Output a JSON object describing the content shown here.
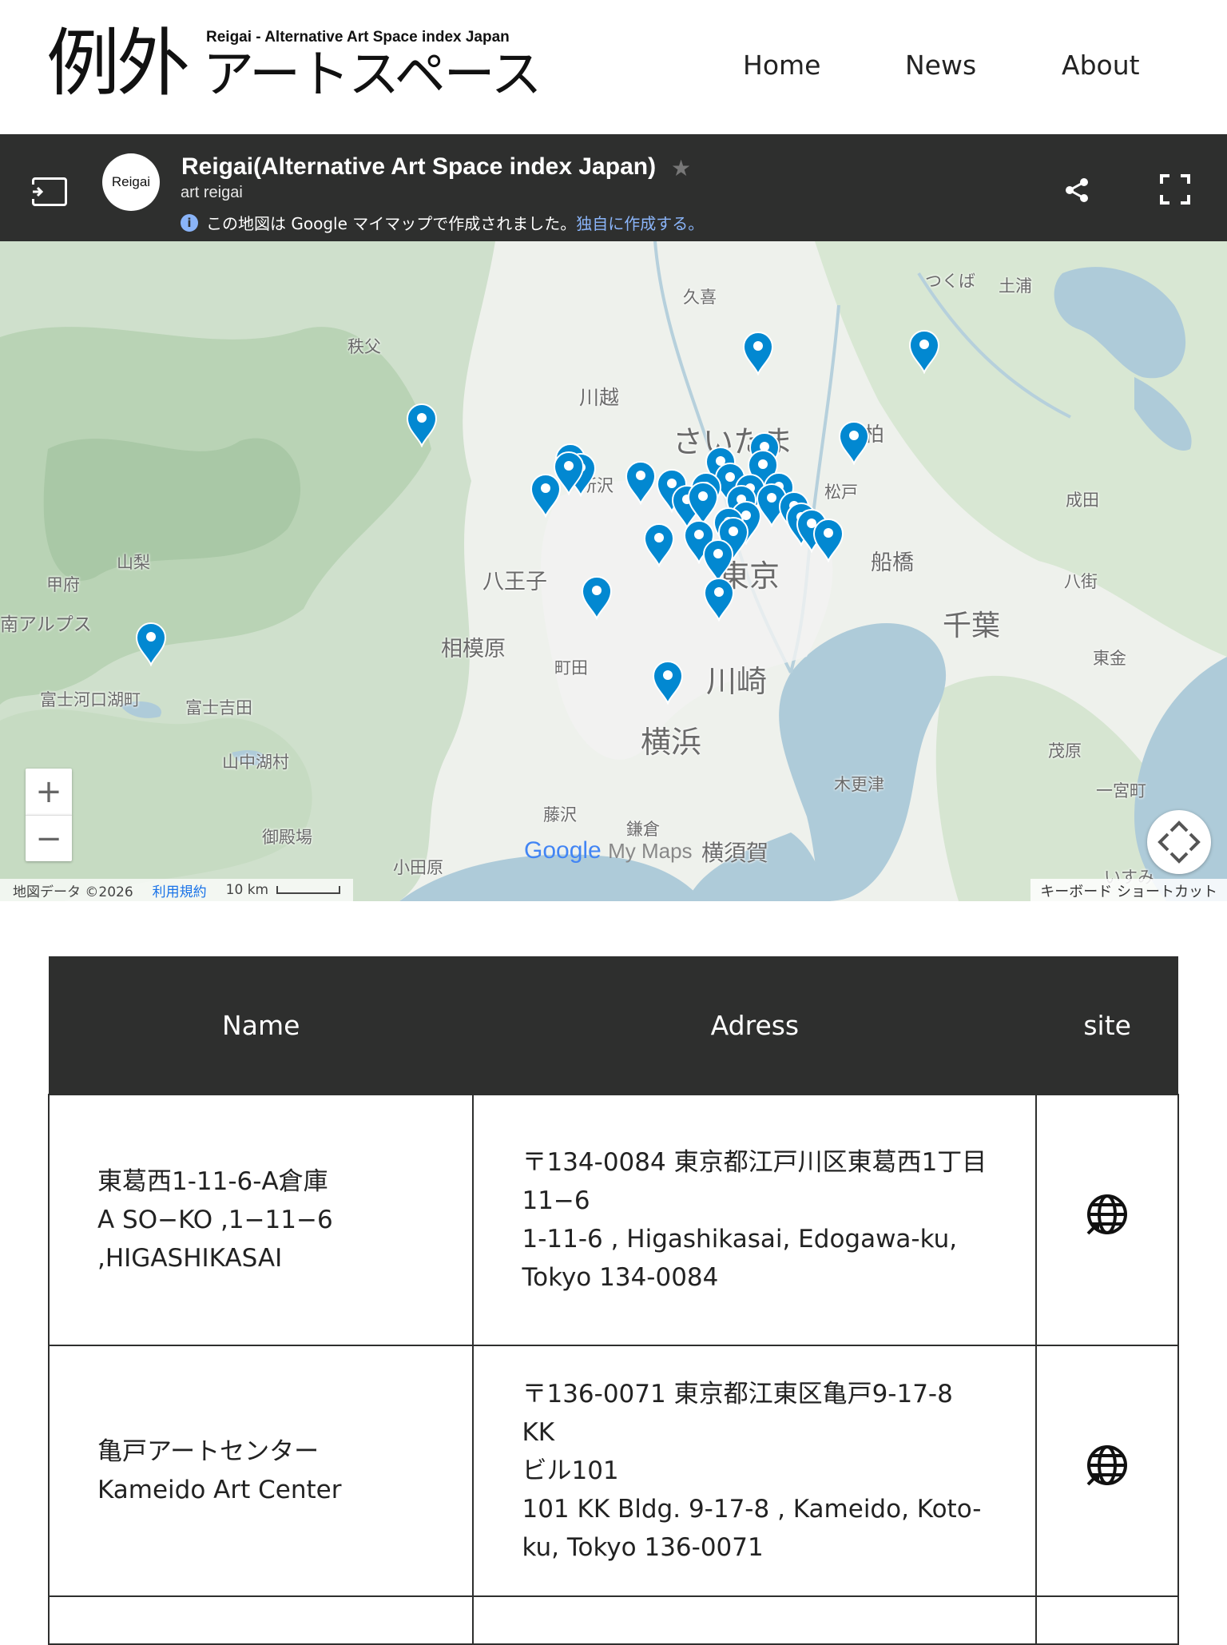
{
  "header": {
    "logo_kanji": "例外",
    "logo_sub": "Reigai - Alternative Art Space index Japan",
    "logo_kana": "アートスペース",
    "nav": [
      "Home",
      "News",
      "About"
    ]
  },
  "map_bar": {
    "avatar_label": "Reigai",
    "title": "Reigai(Alternative Art Space index Japan)",
    "owner": "art reigai",
    "info_text": "この地図は Google マイマップで作成されました。",
    "info_link": "独自に作成する。"
  },
  "map": {
    "places": {
      "kuki": "久喜",
      "tsukuba": "つくば",
      "tsuchiura": "土浦",
      "chichibu": "秩父",
      "kawagoe": "川越",
      "saitama": "さいたま",
      "kashiwa": "柏",
      "tokorozawa": "所沢",
      "matsudo": "松戸",
      "narita": "成田",
      "yamanashi": "山梨",
      "kofu": "甲府",
      "hachioji": "八王子",
      "tokyo": "東京",
      "funabashi": "船橋",
      "yachimata": "八街",
      "minami_alps": "南アルプス",
      "chiba": "千葉",
      "sagamihara": "相模原",
      "machida": "町田",
      "togane": "東金",
      "kawasaki": "川崎",
      "fujikawaguchiko": "富士河口湖町",
      "fujiyoshida": "富士吉田",
      "yokohama": "横浜",
      "mobara": "茂原",
      "yamanakako": "山中湖村",
      "kisarazu": "木更津",
      "ichinomiya": "一宮町",
      "fujisawa": "藤沢",
      "kamakura": "鎌倉",
      "gotemba": "御殿場",
      "odawara": "小田原",
      "yokosuka": "横須賀",
      "isumi": "いすみ"
    },
    "attribution": "地図データ ©2026",
    "terms": "利用規約",
    "scale": "10 km",
    "keyboard": "キーボード ショートカット",
    "logo_google": "Google",
    "logo_mymaps": "My Maps",
    "colors": {
      "pin": "#0288d1",
      "water": "#aecbd9",
      "land": "#eef2ee"
    }
  },
  "table": {
    "headers": [
      "Name",
      "Adress",
      "site"
    ],
    "rows": [
      {
        "name": [
          "東葛西1-11-6-A倉庫",
          "A SO−KO ,1−11−6",
          ",HIGASHIKASAI"
        ],
        "address": [
          "〒134-0084 東京都江戸川区東葛西1丁目",
          "11−6",
          "1-11-6 , Higashikasai, Edogawa-ku,",
          "Tokyo 134-0084"
        ]
      },
      {
        "name": [
          "亀戸アートセンター",
          "Kameido Art Center"
        ],
        "address": [
          "〒136-0071 東京都江東区亀戸9-17-8 KK",
          "ビル101",
          "101 KK Bldg. 9-17-8 , Kameido, Koto-",
          "ku, Tokyo 136-0071"
        ]
      }
    ]
  }
}
